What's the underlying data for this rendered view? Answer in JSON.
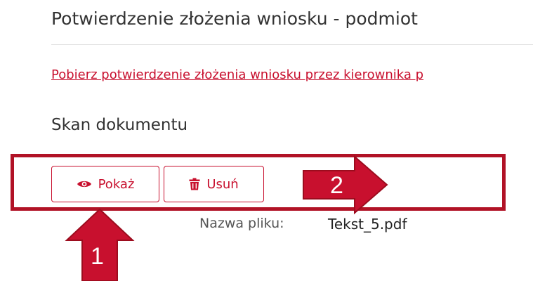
{
  "section": {
    "title": "Potwierdzenie złożenia wniosku - podmiot",
    "download_link": "Pobierz potwierdzenie złożenia wniosku przez kierownika p",
    "subheading": "Skan dokumentu"
  },
  "buttons": {
    "show_label": "Pokaż",
    "delete_label": "Usuń"
  },
  "file": {
    "label": "Nazwa pliku:",
    "name": "Tekst_5.pdf"
  },
  "annotations": {
    "arrow_1_label": "1",
    "arrow_2_label": "2",
    "highlight_color": "#b11226",
    "arrow_color": "#c8102e"
  },
  "icons": {
    "show": "eye-icon",
    "delete": "trash-icon"
  },
  "colors": {
    "accent": "#c8102e",
    "text": "#333333"
  }
}
